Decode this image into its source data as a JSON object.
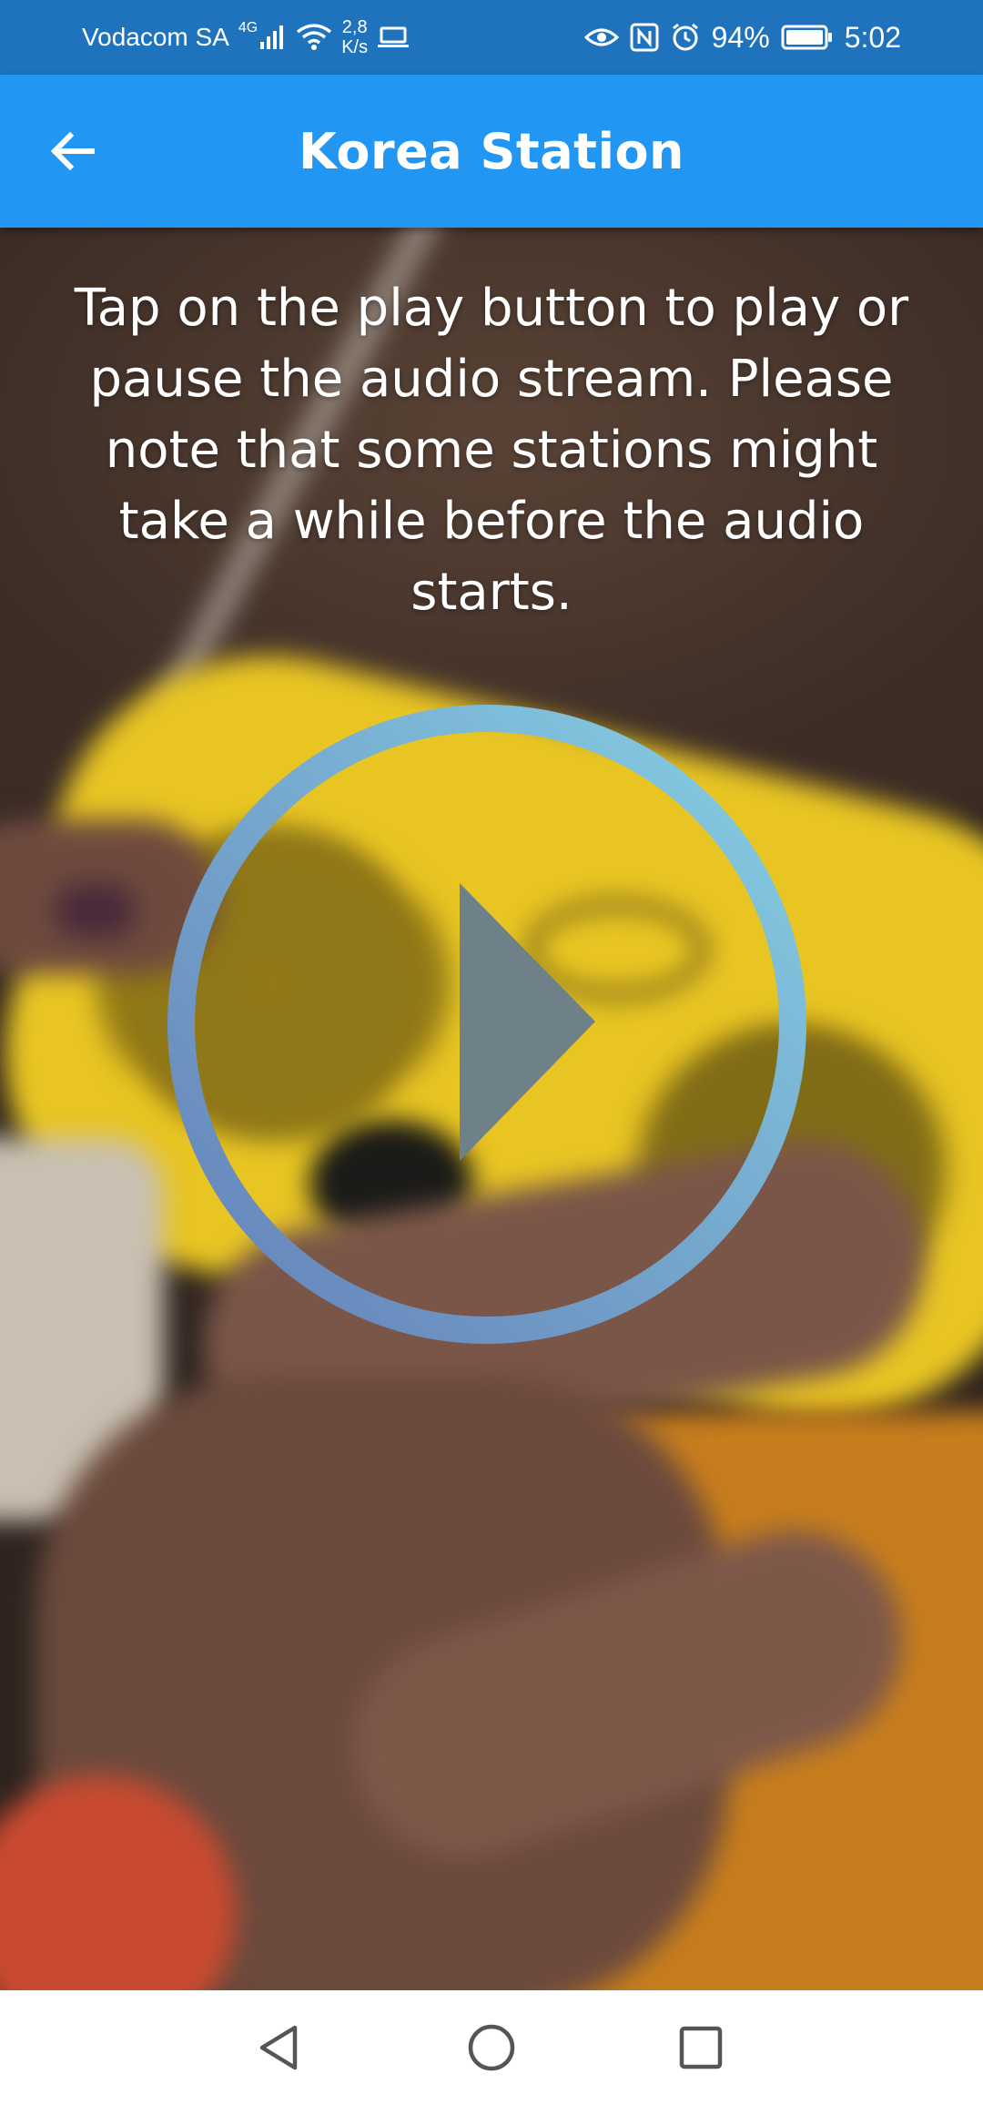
{
  "status_bar": {
    "carrier": "Vodacom SA",
    "network_type": "4G",
    "net_speed_value": "2,8",
    "net_speed_unit": "K/s",
    "battery_percent": "94%",
    "time": "5:02",
    "icons": [
      "signal-icon",
      "wifi-icon",
      "laptop-icon",
      "eye-icon",
      "nfc-icon",
      "alarm-icon",
      "battery-icon"
    ]
  },
  "app_bar": {
    "title": "Korea Station",
    "back_icon": "arrow-left-icon",
    "color": "#2196f3"
  },
  "main": {
    "instructions": "Tap on the play button to play or pause the audio stream. Please note that some stations might take a while before the audio starts.",
    "play_button": {
      "icon": "play-icon",
      "ring_color_start": "#86cfe3",
      "ring_color_end": "#6a8cbd",
      "triangle_color": "#6e8088"
    }
  },
  "nav_bar": {
    "back": "nav-back-icon",
    "home": "nav-home-icon",
    "recents": "nav-recents-icon"
  },
  "colors": {
    "status_bar": "#1e73bc",
    "app_bar": "#2196f3"
  }
}
